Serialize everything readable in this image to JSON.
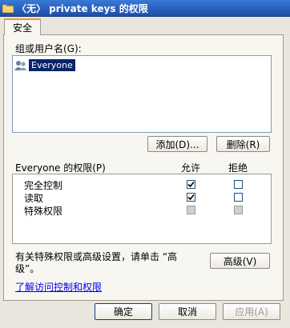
{
  "window": {
    "title": "〈无〉 private keys 的权限"
  },
  "tabs": [
    {
      "label": "安全"
    }
  ],
  "groups": {
    "label": "组或用户名(G):",
    "items": [
      {
        "name": "Everyone",
        "selected": true
      }
    ],
    "add_label": "添加(D)...",
    "remove_label": "删除(R)"
  },
  "permissions": {
    "title": "Everyone 的权限(P)",
    "allow_header": "允许",
    "deny_header": "拒绝",
    "rows": [
      {
        "name": "完全控制",
        "allow": "checked",
        "deny": "unchecked"
      },
      {
        "name": "读取",
        "allow": "checked",
        "deny": "unchecked"
      },
      {
        "name": "特殊权限",
        "allow": "disabled",
        "deny": "disabled"
      }
    ]
  },
  "advanced": {
    "text": "有关特殊权限或高级设置，请单击 “高级”。",
    "button_label": "高级(V)"
  },
  "help_link": "了解访问控制和权限",
  "footer": {
    "ok_label": "确定",
    "cancel_label": "取消",
    "apply_label": "应用(A)"
  }
}
